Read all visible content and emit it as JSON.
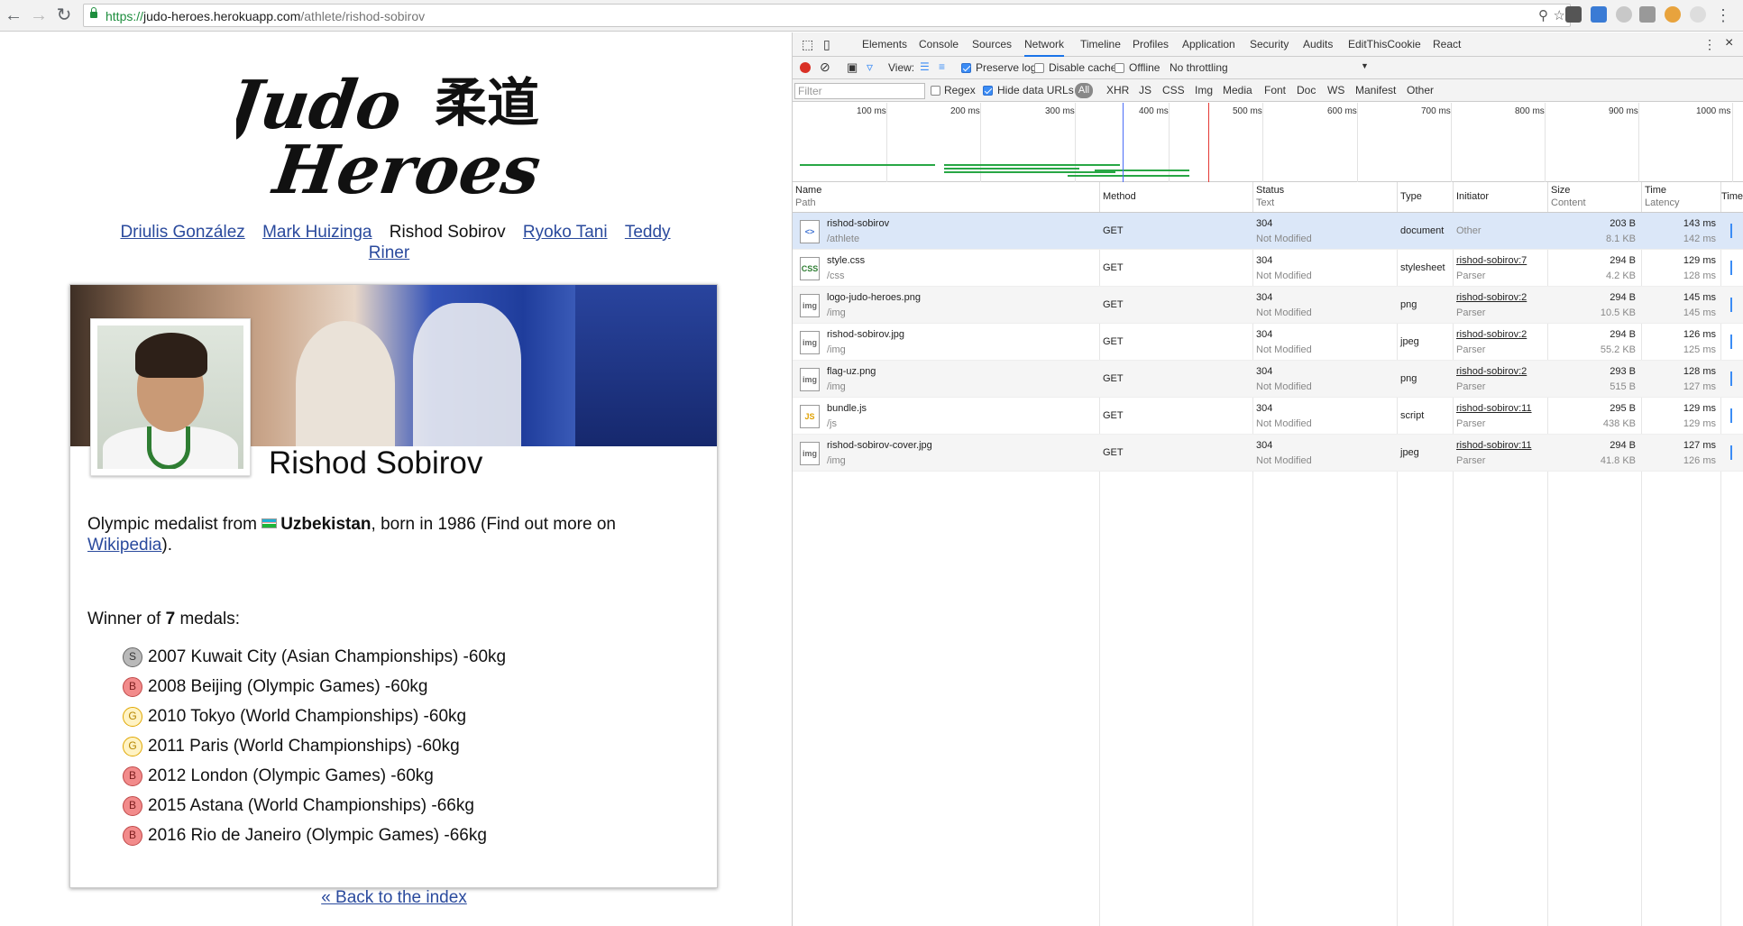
{
  "browser": {
    "url_scheme": "https://",
    "url_host": "judo-heroes.herokuapp.com",
    "url_path": "/athlete/rishod-sobirov"
  },
  "site": {
    "logo_text": "Judo Heroes",
    "logo_kanji": "柔道",
    "nav": [
      {
        "label": "Driulis González",
        "active": false
      },
      {
        "label": "Mark Huizinga",
        "active": false
      },
      {
        "label": "Rishod Sobirov",
        "active": true
      },
      {
        "label": "Ryoko Tani",
        "active": false
      },
      {
        "label": "Teddy Riner",
        "active": false
      }
    ],
    "athlete_name": "Rishod Sobirov",
    "bio_prefix": "Olympic medalist from",
    "country": "Uzbekistan",
    "bio_mid": ", born in 1986 (Find out more on",
    "wiki_link": "Wikipedia",
    "bio_suffix": ").",
    "winner_prefix": "Winner of",
    "medal_count": "7",
    "winner_suffix": "medals:",
    "medals": [
      {
        "type": "S",
        "text": "2007 Kuwait City (Asian Championships) -60kg"
      },
      {
        "type": "B",
        "text": "2008 Beijing (Olympic Games) -60kg"
      },
      {
        "type": "G",
        "text": "2010 Tokyo (World Championships) -60kg"
      },
      {
        "type": "G",
        "text": "2011 Paris (World Championships) -60kg"
      },
      {
        "type": "B",
        "text": "2012 London (Olympic Games) -60kg"
      },
      {
        "type": "B",
        "text": "2015 Astana (World Championships) -66kg"
      },
      {
        "type": "B",
        "text": "2016 Rio de Janeiro (Olympic Games) -66kg"
      }
    ],
    "back_link": "« Back to the index"
  },
  "devtools": {
    "tabs": [
      "Elements",
      "Console",
      "Sources",
      "Network",
      "Timeline",
      "Profiles",
      "Application",
      "Security",
      "Audits",
      "EditThisCookie",
      "React"
    ],
    "active_tab": "Network",
    "toolbar": {
      "view_label": "View:",
      "preserve_log": "Preserve log",
      "disable_cache": "Disable cache",
      "offline": "Offline",
      "throttling": "No throttling"
    },
    "filter": {
      "placeholder": "Filter",
      "regex": "Regex",
      "hide_data_urls": "Hide data URLs",
      "all": "All",
      "types": [
        "XHR",
        "JS",
        "CSS",
        "Img",
        "Media",
        "Font",
        "Doc",
        "WS",
        "Manifest",
        "Other"
      ]
    },
    "timeline_ticks": [
      "100 ms",
      "200 ms",
      "300 ms",
      "400 ms",
      "500 ms",
      "600 ms",
      "700 ms",
      "800 ms",
      "900 ms",
      "1000 ms"
    ],
    "columns": {
      "name": "Name",
      "path": "Path",
      "method": "Method",
      "status": "Status",
      "text": "Text",
      "type": "Type",
      "initiator": "Initiator",
      "size": "Size",
      "content": "Content",
      "time": "Time",
      "latency": "Latency",
      "timeline": "Timel"
    },
    "requests": [
      {
        "icon": "<>",
        "name": "rishod-sobirov",
        "path": "/athlete",
        "method": "GET",
        "status": "304",
        "text": "Not Modified",
        "type": "document",
        "initiator": "Other",
        "initiator_sub": "",
        "size": "203 B",
        "content": "8.1 KB",
        "time": "143 ms",
        "latency": "142 ms"
      },
      {
        "icon": "CSS",
        "name": "style.css",
        "path": "/css",
        "method": "GET",
        "status": "304",
        "text": "Not Modified",
        "type": "stylesheet",
        "initiator": "rishod-sobirov:7",
        "initiator_sub": "Parser",
        "size": "294 B",
        "content": "4.2 KB",
        "time": "129 ms",
        "latency": "128 ms"
      },
      {
        "icon": "img",
        "name": "logo-judo-heroes.png",
        "path": "/img",
        "method": "GET",
        "status": "304",
        "text": "Not Modified",
        "type": "png",
        "initiator": "rishod-sobirov:2",
        "initiator_sub": "Parser",
        "size": "294 B",
        "content": "10.5 KB",
        "time": "145 ms",
        "latency": "145 ms"
      },
      {
        "icon": "img",
        "name": "rishod-sobirov.jpg",
        "path": "/img",
        "method": "GET",
        "status": "304",
        "text": "Not Modified",
        "type": "jpeg",
        "initiator": "rishod-sobirov:2",
        "initiator_sub": "Parser",
        "size": "294 B",
        "content": "55.2 KB",
        "time": "126 ms",
        "latency": "125 ms"
      },
      {
        "icon": "img",
        "name": "flag-uz.png",
        "path": "/img",
        "method": "GET",
        "status": "304",
        "text": "Not Modified",
        "type": "png",
        "initiator": "rishod-sobirov:2",
        "initiator_sub": "Parser",
        "size": "293 B",
        "content": "515 B",
        "time": "128 ms",
        "latency": "127 ms"
      },
      {
        "icon": "JS",
        "name": "bundle.js",
        "path": "/js",
        "method": "GET",
        "status": "304",
        "text": "Not Modified",
        "type": "script",
        "initiator": "rishod-sobirov:11",
        "initiator_sub": "Parser",
        "size": "295 B",
        "content": "438 KB",
        "time": "129 ms",
        "latency": "129 ms"
      },
      {
        "icon": "img",
        "name": "rishod-sobirov-cover.jpg",
        "path": "/img",
        "method": "GET",
        "status": "304",
        "text": "Not Modified",
        "type": "jpeg",
        "initiator": "rishod-sobirov:11",
        "initiator_sub": "Parser",
        "size": "294 B",
        "content": "41.8 KB",
        "time": "127 ms",
        "latency": "126 ms"
      }
    ]
  }
}
